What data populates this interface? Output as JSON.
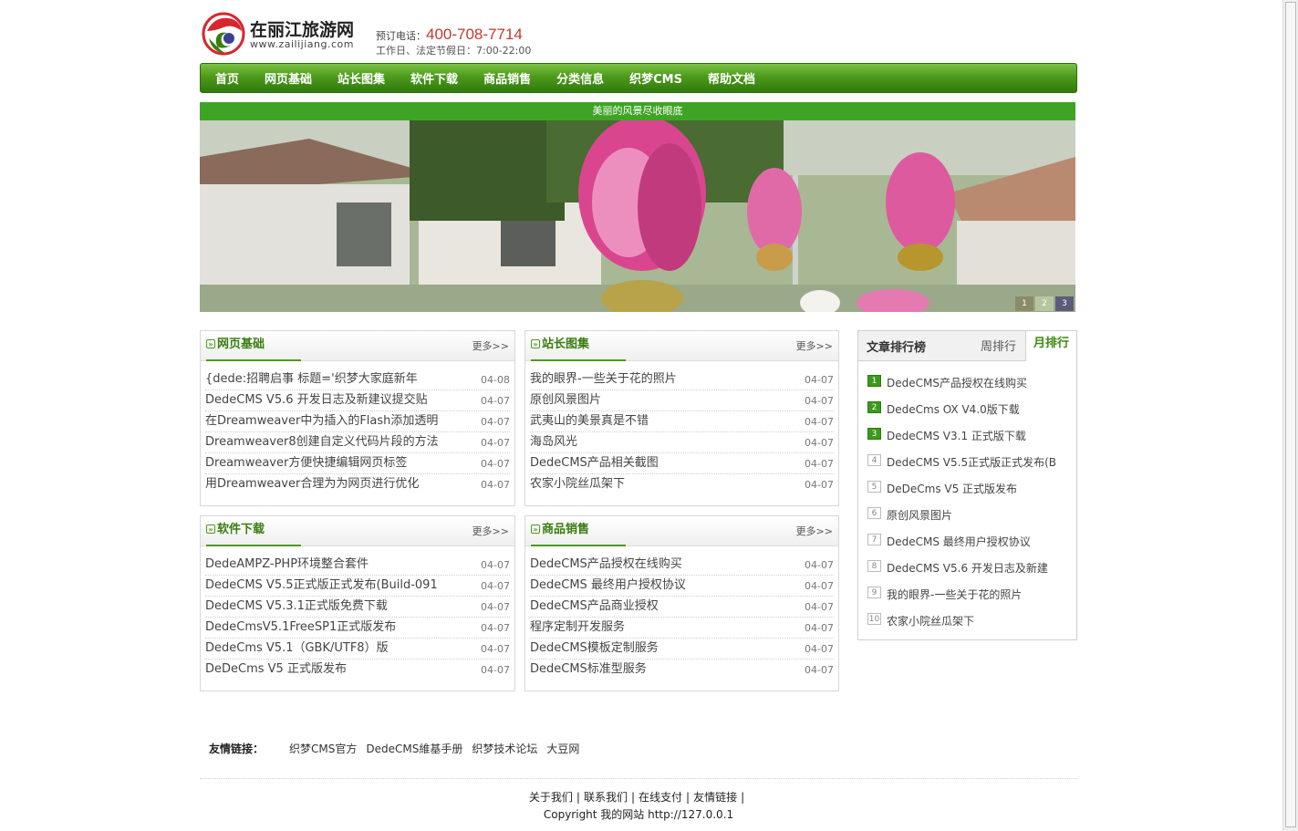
{
  "header": {
    "brand": "在丽江旅游网",
    "domain": "www.zailijiang.com",
    "phone_label": "预订电话：",
    "phone": "400-708-7714",
    "hours": "工作日、法定节假日：7:00-22:00"
  },
  "nav": [
    "首页",
    "网页基础",
    "站长图集",
    "软件下载",
    "商品销售",
    "分类信息",
    "织梦CMS",
    "帮助文档"
  ],
  "banner": {
    "caption": "美丽的风景尽收眼底",
    "dots": [
      "1",
      "2",
      "3"
    ]
  },
  "boxes": [
    {
      "title": "网页基础",
      "more": "更多>>",
      "items": [
        {
          "t": "{dede:招聘启事  标题='织梦大家庭新年",
          "d": "04-08"
        },
        {
          "t": "DedeCMS V5.6 开发日志及新建议提交贴",
          "d": "04-07"
        },
        {
          "t": "在Dreamweaver中为插入的Flash添加透明",
          "d": "04-07"
        },
        {
          "t": "Dreamweaver8创建自定义代码片段的方法",
          "d": "04-07"
        },
        {
          "t": "Dreamweaver方便快捷编辑网页标签",
          "d": "04-07"
        },
        {
          "t": "用Dreamweaver合理为为网页进行优化",
          "d": "04-07"
        }
      ]
    },
    {
      "title": "站长图集",
      "more": "更多>>",
      "items": [
        {
          "t": "我的眼界-一些关于花的照片",
          "d": "04-07"
        },
        {
          "t": "原创风景图片",
          "d": "04-07"
        },
        {
          "t": "武夷山的美景真是不错",
          "d": "04-07"
        },
        {
          "t": "海岛风光",
          "d": "04-07"
        },
        {
          "t": "DedeCMS产品相关截图",
          "d": "04-07"
        },
        {
          "t": "农家小院丝瓜架下",
          "d": "04-07"
        }
      ]
    },
    {
      "title": "软件下载",
      "more": "更多>>",
      "items": [
        {
          "t": "DedeAMPZ-PHP环境整合套件",
          "d": "04-07"
        },
        {
          "t": "DedeCMS V5.5正式版正式发布(Build-091",
          "d": "04-07"
        },
        {
          "t": "DedeCMS V5.3.1正式版免费下载",
          "d": "04-07"
        },
        {
          "t": "DedeCmsV5.1FreeSP1正式版发布",
          "d": "04-07"
        },
        {
          "t": "DedeCms V5.1（GBK/UTF8）版",
          "d": "04-07"
        },
        {
          "t": "DeDeCms V5 正式版发布",
          "d": "04-07"
        }
      ]
    },
    {
      "title": "商品销售",
      "more": "更多>>",
      "items": [
        {
          "t": "DedeCMS产品授权在线购买",
          "d": "04-07"
        },
        {
          "t": "DedeCMS 最终用户授权协议",
          "d": "04-07"
        },
        {
          "t": "DedeCMS产品商业授权",
          "d": "04-07"
        },
        {
          "t": "程序定制开发服务",
          "d": "04-07"
        },
        {
          "t": "DedeCMS模板定制服务",
          "d": "04-07"
        },
        {
          "t": "DedeCMS标准型服务",
          "d": "04-07"
        }
      ]
    }
  ],
  "rank": {
    "title": "文章排行榜",
    "tab_week": "周排行",
    "tab_month": "月排行",
    "items": [
      {
        "n": "1",
        "t": "DedeCMS产品授权在线购买"
      },
      {
        "n": "2",
        "t": "DedeCms OX V4.0版下载"
      },
      {
        "n": "3",
        "t": "DedeCMS V3.1 正式版下载"
      },
      {
        "n": "4",
        "t": "DedeCMS V5.5正式版正式发布(B"
      },
      {
        "n": "5",
        "t": "DeDeCms V5 正式版发布"
      },
      {
        "n": "6",
        "t": "原创风景图片"
      },
      {
        "n": "7",
        "t": "DedeCMS 最终用户授权协议"
      },
      {
        "n": "8",
        "t": "DedeCMS V5.6 开发日志及新建"
      },
      {
        "n": "9",
        "t": "我的眼界-一些关于花的照片"
      },
      {
        "n": "10",
        "t": "农家小院丝瓜架下"
      }
    ]
  },
  "friend_links": {
    "label": "友情链接：",
    "links": [
      "织梦CMS官方",
      "DedeCMS維基手册",
      "织梦技术论坛",
      "大豆网"
    ]
  },
  "footer": {
    "nav": [
      "关于我们",
      "联系我们",
      "在线支付",
      "友情链接"
    ],
    "copyright": "Copyright 我的网站  http://127.0.0.1"
  }
}
